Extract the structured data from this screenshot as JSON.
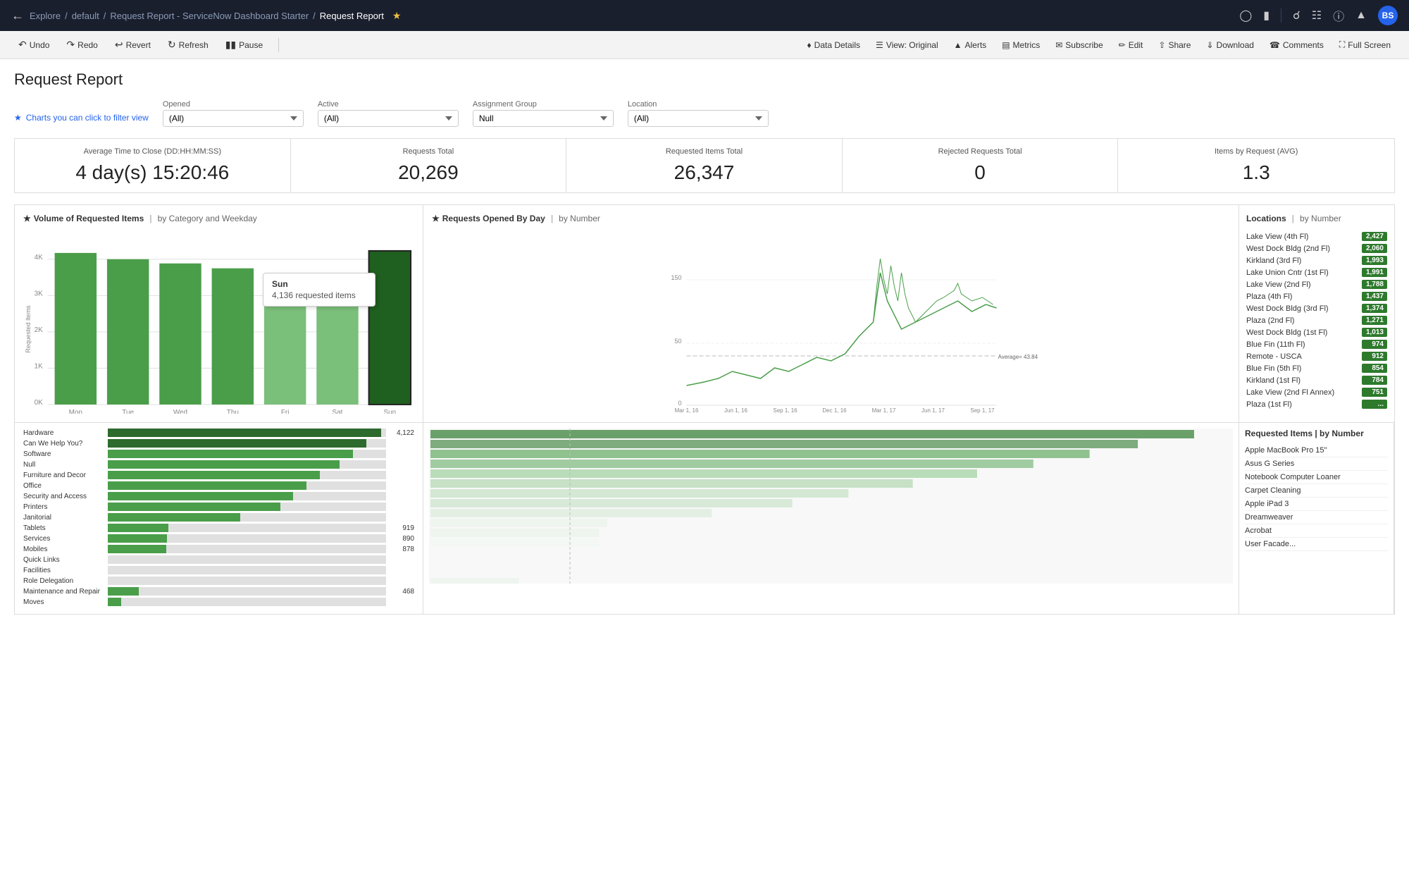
{
  "topnav": {
    "back_icon": "←",
    "breadcrumbs": [
      "Explore",
      "default",
      "Request Report - ServiceNow Dashboard Starter",
      "Request Report"
    ],
    "star_icon": "★",
    "icons": [
      "mobile-icon",
      "barcode-icon",
      "search-icon",
      "list-icon",
      "help-icon",
      "bell-icon"
    ],
    "avatar_label": "BS"
  },
  "toolbar": {
    "undo_label": "Undo",
    "redo_label": "Redo",
    "revert_label": "Revert",
    "refresh_label": "Refresh",
    "pause_label": "Pause",
    "data_details_label": "Data Details",
    "view_label": "View: Original",
    "alerts_label": "Alerts",
    "metrics_label": "Metrics",
    "subscribe_label": "Subscribe",
    "edit_label": "Edit",
    "share_label": "Share",
    "download_label": "Download",
    "comments_label": "Comments",
    "fullscreen_label": "Full Screen"
  },
  "page": {
    "title": "Request Report"
  },
  "filters": {
    "hint": "Charts you can click to filter view",
    "opened": {
      "label": "Opened",
      "value": "(All)"
    },
    "active": {
      "label": "Active",
      "value": "(All)"
    },
    "assignment_group": {
      "label": "Assignment Group",
      "value": "Null"
    },
    "location": {
      "label": "Location",
      "value": "(All)"
    }
  },
  "kpis": [
    {
      "label": "Average Time to Close (DD:HH:MM:SS)",
      "value": "4 day(s) 15:20:46"
    },
    {
      "label": "Requests Total",
      "value": "20,269"
    },
    {
      "label": "Requested Items Total",
      "value": "26,347"
    },
    {
      "label": "Rejected Requests Total",
      "value": "0"
    },
    {
      "label": "Items by Request (AVG)",
      "value": "1.3"
    }
  ],
  "bar_chart": {
    "title": "Volume of Requested Items",
    "pipe": "|",
    "subtitle": "by Category and Weekday",
    "y_label": "Requested Items",
    "y_ticks": [
      "0K",
      "1K",
      "2K",
      "3K",
      "4K"
    ],
    "x_labels": [
      "Mon",
      "Tue",
      "Wed",
      "Thu",
      "Fri",
      "Sat",
      "Sun"
    ],
    "bars": [
      {
        "label": "Mon",
        "value": 4050,
        "selected": false
      },
      {
        "label": "Tue",
        "value": 3900,
        "selected": false
      },
      {
        "label": "Wed",
        "value": 3800,
        "selected": false
      },
      {
        "label": "Thu",
        "value": 3700,
        "selected": false
      },
      {
        "label": "Fri",
        "value": 3300,
        "selected": false
      },
      {
        "label": "Sat",
        "value": 3050,
        "selected": false
      },
      {
        "label": "Sun",
        "value": 4136,
        "selected": true
      }
    ],
    "max_value": 4500,
    "tooltip": {
      "label": "Sun",
      "value": "4,136 requested items"
    }
  },
  "line_chart": {
    "title": "Requests Opened By Day",
    "pipe": "|",
    "subtitle": "by Number",
    "y_ticks": [
      "0",
      "50",
      "150"
    ],
    "x_labels": [
      "Mar 1, 16",
      "Jun 1, 16",
      "Sep 1, 16",
      "Dec 1, 16",
      "Mar 1, 17",
      "Jun 1, 17",
      "Sep 1, 17"
    ],
    "average_label": "Average= 43.84"
  },
  "locations": {
    "title": "Locations",
    "pipe": "|",
    "subtitle": "by Number",
    "items": [
      {
        "name": "Lake View (4th Fl)",
        "value": "2,427"
      },
      {
        "name": "West Dock Bldg (2nd Fl)",
        "value": "2,060"
      },
      {
        "name": "Kirkland (3rd Fl)",
        "value": "1,993"
      },
      {
        "name": "Lake Union Cntr (1st Fl)",
        "value": "1,991"
      },
      {
        "name": "Lake View (2nd Fl)",
        "value": "1,788"
      },
      {
        "name": "Plaza (4th Fl)",
        "value": "1,437"
      },
      {
        "name": "West Dock Bldg (3rd Fl)",
        "value": "1,374"
      },
      {
        "name": "Plaza (2nd Fl)",
        "value": "1,271"
      },
      {
        "name": "West Dock Bldg (1st Fl)",
        "value": "1,013"
      },
      {
        "name": "Blue Fin (11th Fl)",
        "value": "974"
      },
      {
        "name": "Remote - USCA",
        "value": "912"
      },
      {
        "name": "Blue Fin (5th Fl)",
        "value": "854"
      },
      {
        "name": "Kirkland (1st Fl)",
        "value": "784"
      },
      {
        "name": "Lake View (2nd Fl Annex)",
        "value": "751"
      },
      {
        "name": "Plaza (1st Fl)",
        "value": "..."
      }
    ]
  },
  "hbars": {
    "max_value": 4200,
    "items": [
      {
        "label": "Hardware",
        "value": 4122,
        "show_num": true,
        "dark": true
      },
      {
        "label": "Can We Help You?",
        "value": 3900,
        "show_num": false,
        "dark": true
      },
      {
        "label": "Software",
        "value": 3700,
        "show_num": false,
        "dark": false
      },
      {
        "label": "Null",
        "value": 3500,
        "show_num": false,
        "dark": false
      },
      {
        "label": "Furniture and Decor",
        "value": 3200,
        "show_num": false,
        "dark": false
      },
      {
        "label": "Office",
        "value": 3000,
        "show_num": false,
        "dark": false
      },
      {
        "label": "Security and Access",
        "value": 2800,
        "show_num": false,
        "dark": false
      },
      {
        "label": "Printers",
        "value": 2600,
        "show_num": false,
        "dark": false
      },
      {
        "label": "Janitorial",
        "value": 2000,
        "show_num": false,
        "dark": false
      },
      {
        "label": "Tablets",
        "value": 919,
        "show_num": true,
        "dark": false
      },
      {
        "label": "Services",
        "value": 890,
        "show_num": true,
        "dark": false
      },
      {
        "label": "Mobiles",
        "value": 878,
        "show_num": true,
        "dark": false
      },
      {
        "label": "Quick Links",
        "value": 0,
        "show_num": false,
        "dark": false
      },
      {
        "label": "Facilities",
        "value": 0,
        "show_num": false,
        "dark": false
      },
      {
        "label": "Role Delegation",
        "value": 0,
        "show_num": false,
        "dark": false
      },
      {
        "label": "Maintenance and Repair",
        "value": 468,
        "show_num": true,
        "dark": false
      },
      {
        "label": "Moves",
        "value": 200,
        "show_num": false,
        "dark": false
      }
    ],
    "hbar_num_4122": "4,122",
    "hbar_num_919": "919",
    "hbar_num_890": "890",
    "hbar_num_878": "878",
    "hbar_num_468": "468"
  },
  "req_items": {
    "title": "Requested Items | by Number",
    "items": [
      "Apple MacBook Pro 15\"",
      "Asus G Series",
      "Notebook Computer Loaner",
      "Carpet Cleaning",
      "Apple iPad 3",
      "Dreamweaver",
      "Acrobat",
      "User Facade..."
    ]
  }
}
